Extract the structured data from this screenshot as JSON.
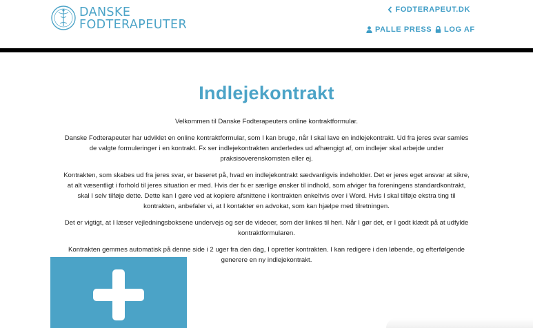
{
  "header": {
    "logo": {
      "line1": "DANSKE",
      "line2": "FODTERAPEUTER",
      "seal_text": "DANSKE FODTERAPEUTER"
    },
    "site_link": {
      "icon": "chevron-left-icon",
      "label": "FODTERAPEUT.DK"
    },
    "user_link": {
      "icon": "user-icon",
      "label": "PALLE PRESS"
    },
    "logout_link": {
      "icon": "lock-icon",
      "label": "LOG AF"
    }
  },
  "main": {
    "title": "Indlejekontrakt",
    "paragraphs": [
      "Velkommen til Danske Fodterapeuters online kontraktformular.",
      "Danske Fodterapeuter har udviklet en online kontraktformular, som I kan bruge, når I skal lave en indlejekontrakt. Ud fra jeres svar samles de valgte formuleringer i en kontrakt. Fx ser indlejekontrakten anderledes ud afhængigt af, om indlejer skal arbejde under praksisoverenskomsten eller ej.",
      "Kontrakten, som skabes ud fra jeres svar, er baseret på, hvad en indlejekontrakt sædvanligvis indeholder. Det er jeres eget ansvar at sikre, at alt væsentligt i forhold til jeres situation er med. Hvis der fx er særlige ønsker til indhold, som afviger fra foreningens standardkontrakt, skal I selv tilføje dette. Dette kan I gøre ved at kopiere afsnittene i kontrakten enkeltvis over i Word. Hvis I skal tilføje ekstra ting til kontrakten, anbefaler vi, at I kontakter en advokat, som kan hjælpe med tilretningen.",
      "Det er vigtigt, at I læser vejledningsboksene undervejs og ser de videoer, som der linkes til heri. Når I gør det, er I godt klædt på at udfylde kontraktformularen.",
      "Kontrakten gemmes automatisk på denne side i 2 uger fra den dag, I opretter kontrakten. I kan redigere i den løbende, og efterfølgende generere en ny indlejekontrakt."
    ],
    "add_card": {
      "icon": "plus-icon"
    }
  },
  "colors": {
    "accent": "#4ba3c7",
    "header_bar": "#000000",
    "text": "#222222"
  }
}
